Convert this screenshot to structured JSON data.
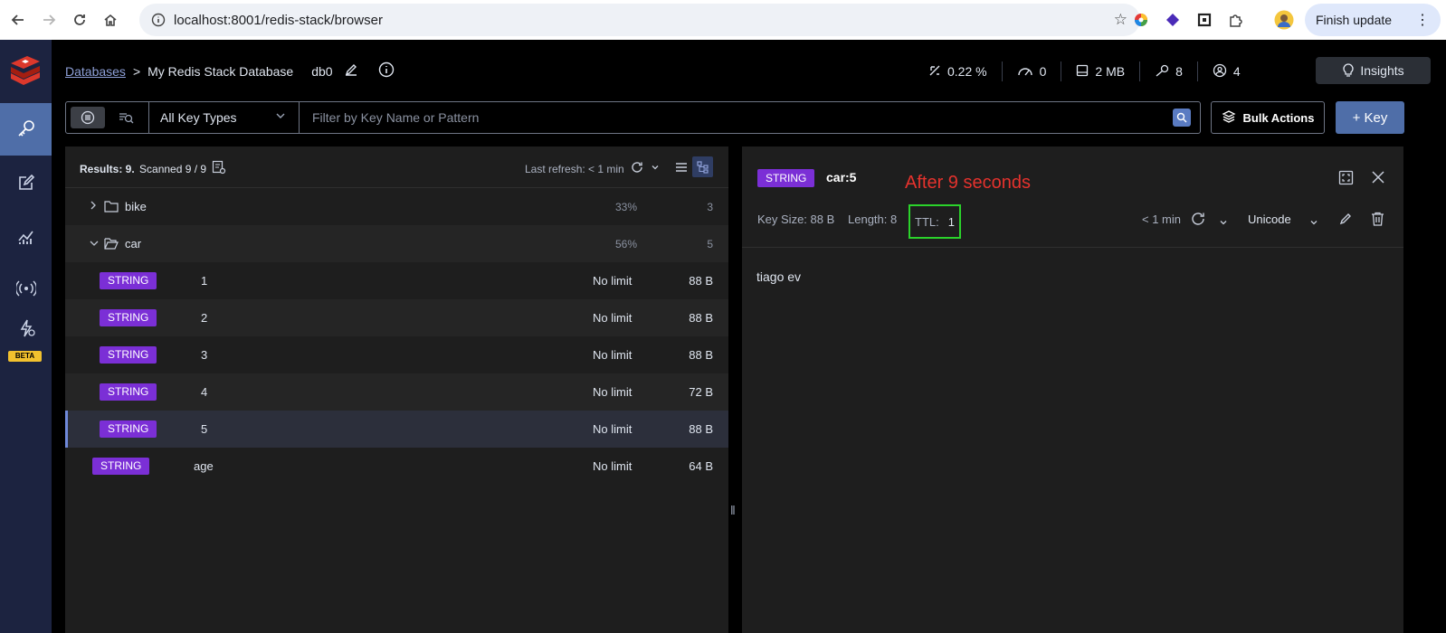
{
  "browser": {
    "url": "localhost:8001/redis-stack/browser",
    "finish_update_label": "Finish update"
  },
  "sidebar": {
    "beta_label": "BETA"
  },
  "header": {
    "breadcrumb_databases": "Databases",
    "breadcrumb_sep": ">",
    "database_name": "My Redis Stack Database",
    "db_index": "db0",
    "stats": {
      "cpu": "0.22 %",
      "ops": "0",
      "memory": "2 MB",
      "keys": "8",
      "clients": "4"
    },
    "insights_label": "Insights"
  },
  "toolbar": {
    "key_type": "All Key Types",
    "filter_placeholder": "Filter by Key Name or Pattern",
    "bulk_actions_label": "Bulk Actions",
    "add_key_label": "+ Key"
  },
  "key_list": {
    "results_label": "Results: 9.",
    "scanned_label": "Scanned 9 / 9",
    "last_refresh": "Last refresh: < 1 min",
    "folders": [
      {
        "name": "bike",
        "percent": "33%",
        "count": "3"
      },
      {
        "name": "car",
        "percent": "56%",
        "count": "5"
      }
    ],
    "keys": [
      {
        "type": "STRING",
        "name": "1",
        "ttl": "No limit",
        "size": "88 B"
      },
      {
        "type": "STRING",
        "name": "2",
        "ttl": "No limit",
        "size": "88 B"
      },
      {
        "type": "STRING",
        "name": "3",
        "ttl": "No limit",
        "size": "88 B"
      },
      {
        "type": "STRING",
        "name": "4",
        "ttl": "No limit",
        "size": "72 B"
      },
      {
        "type": "STRING",
        "name": "5",
        "ttl": "No limit",
        "size": "88 B"
      },
      {
        "type": "STRING",
        "name": "age",
        "ttl": "No limit",
        "size": "64 B"
      }
    ]
  },
  "detail": {
    "type": "STRING",
    "key": "car:5",
    "annotation": "After 9 seconds",
    "key_size": "Key Size: 88 B",
    "length": "Length: 8",
    "ttl_label": "TTL:",
    "ttl_value": "1",
    "refresh": "< 1 min",
    "format": "Unicode",
    "value": "tiago ev"
  }
}
